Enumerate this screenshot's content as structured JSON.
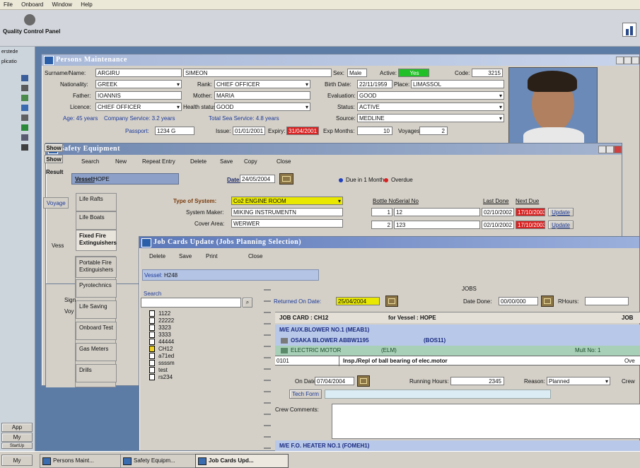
{
  "menu": [
    "File",
    "Onboard",
    "Window",
    "Help"
  ],
  "toolbar": {
    "qcp_label": "Quality Control Panel"
  },
  "left_strip": {
    "items": [
      "erstede",
      "plicatio"
    ],
    "bottom": [
      "App",
      "My",
      "StartUp",
      "My"
    ]
  },
  "persons": {
    "title": "Persons Maintenance",
    "surname_label": "Surname/Name:",
    "surname": "ARGIRU",
    "name": "SIMEON",
    "sex_label": "Sex:",
    "sex": "Male",
    "active_label": "Active:",
    "active": "Yes",
    "code_label": "Code:",
    "code": "3215",
    "nationality_label": "Nationality:",
    "nationality": "GREEK",
    "rank_label": "Rank:",
    "rank": "CHIEF OFFICER",
    "birth_label": "Birth Date:",
    "birth": "22/11/1959",
    "place_label": "Place:",
    "place": "LIMASSOL",
    "father_label": "Father:",
    "father": "IOANNIS",
    "mother_label": "Mother:",
    "mother": "MARIA",
    "evaluation_label": "Evaluation:",
    "evaluation": "GOOD",
    "licence_label": "Licence:",
    "licence": "CHIEF OFFICER",
    "health_label": "Health status:",
    "health": "GOOD",
    "status_label": "Status:",
    "status": "ACTIVE",
    "age_text": "Age: 45 years",
    "company_service": "Company Service: 3.2 years",
    "total_sea": "Total Sea Service: 4.8 years",
    "source_label": "Source:",
    "source": "MEDLINE",
    "passport_label": "Passport:",
    "passport": "1234 G",
    "issue_label": "Issue:",
    "issue": "01/01/2001",
    "expiry_label": "Expiry:",
    "expiry": "31/04/2001",
    "expmonths_label": "Exp Months:",
    "expmonths": "10",
    "voyages_label": "Voyages:",
    "voyages": "2"
  },
  "safety": {
    "title": "Safety Equipment",
    "side_labels": [
      "Show",
      "Show",
      "Result"
    ],
    "toolbar": [
      "Search",
      "New",
      "Repeat Entry",
      "Delete",
      "Save",
      "Copy",
      "Close"
    ],
    "vessel_label": "Vessel:",
    "vessel": "HOPE",
    "date_label": "Date:",
    "date": "24/05/2004",
    "legend_due": "Due in 1 Month",
    "legend_overdue": "Overdue",
    "categories": [
      "Life Rafts",
      "Life Boats",
      "Fixed Fire Extinguishers",
      "Portable Fire Extinguishers",
      "Pyrotechnics",
      "Life Saving",
      "Onboard Test",
      "Gas Meters",
      "Drills"
    ],
    "left_tabs": [
      "Voyage",
      "Vess",
      "Sign",
      "Voy"
    ],
    "type_label": "Type of System:",
    "type": "Co2 ENGINE ROOM",
    "maker_label": "System Maker:",
    "maker": "MIKING INSTRUMENTN",
    "cover_label": "Cover Area:",
    "cover": "WERWER",
    "col_headers": [
      "Bottle No",
      "Serial No",
      "Last Done",
      "Next Due"
    ],
    "rows": [
      {
        "no": "1",
        "serial": "12",
        "last": "02/10/2002",
        "next": "17/10/2003",
        "action": "Update"
      },
      {
        "no": "2",
        "serial": "123",
        "last": "02/10/2002",
        "next": "17/10/2003",
        "action": "Update"
      }
    ]
  },
  "jobcards": {
    "title": "Job Cards Update (Jobs Planning Selection)",
    "toolbar": [
      "Delete",
      "Save",
      "Print",
      "Close"
    ],
    "vessel_label": "Vessel:",
    "vessel": "H248",
    "search_label": "Search",
    "tree": [
      "1122",
      "22222",
      "3323",
      "3333",
      "44444",
      "CH12",
      "a71ed",
      "ssssm",
      "test",
      "rs234"
    ],
    "returned_label": "Returned On Date:",
    "returned": "25/04/2004",
    "jobs_label": "JOBS",
    "datedone_label": "Date Done:",
    "datedone": "00/00/000",
    "rhours_label": "RHours:",
    "jobcard_label": "JOB CARD : CH12",
    "for_vessel": "for Vessel : HOPE",
    "job_right": "JOB",
    "machine1": "M/E AUX.BLOWER NO.1 (MEAB1)",
    "machine1_sub": "OSAKA BLOWER ABBW1195",
    "machine1_code": "(BOS11)",
    "motor": "ELECTRIC MOTOR",
    "motor_code": "(ELM)",
    "mult_label": "Mult No: 1",
    "task_code": "0101",
    "task_desc": "Insp./Repl of ball bearing of elec.motor",
    "task_right": "Ove",
    "ondate_label": "On Date:",
    "ondate": "07/04/2004",
    "running_label": "Running Hours:",
    "running": "2345",
    "reason_label": "Reason:",
    "reason": "Planned",
    "crew_label": "Crew",
    "techform": "Tech Form",
    "crew_comments_label": "Crew Comments:",
    "machine2": "M/E F.O. HEATER NO.1 (FOMEH1)"
  },
  "taskbar": [
    "Persons Maint...",
    "Safety Equipm...",
    "Job Cards Upd..."
  ],
  "colors": {
    "active_green": "#22c028",
    "overdue_red": "#d82020",
    "due_blue": "#2040c0",
    "title_bg": "#a8b8d8",
    "highlight_yellow": "#e8e800"
  }
}
